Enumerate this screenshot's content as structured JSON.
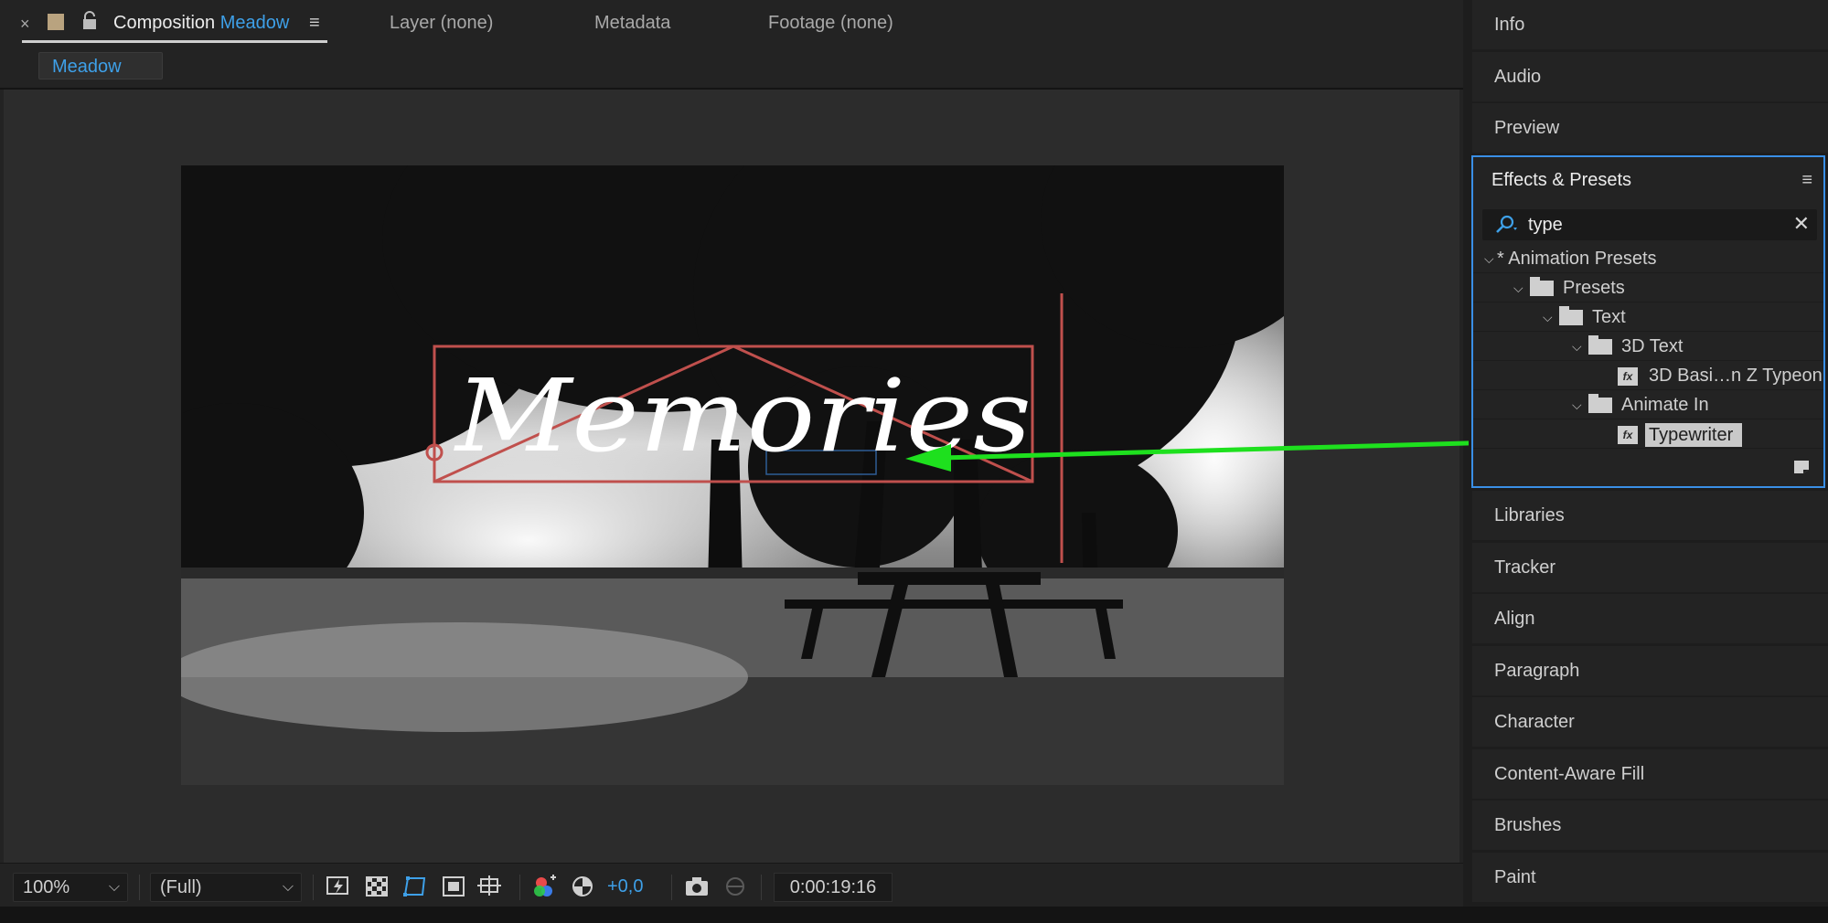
{
  "tabs": {
    "composition_prefix": "Composition",
    "composition_name": "Meadow",
    "layer": "Layer (none)",
    "metadata": "Metadata",
    "footage": "Footage (none)",
    "close_glyph": "×",
    "menu_glyph": "≡"
  },
  "breadcrumb": {
    "current": "Meadow"
  },
  "viewer": {
    "scene_text": "Memories"
  },
  "toolbar": {
    "zoom": "100%",
    "resolution": "(Full)",
    "exposure": "+0,0",
    "timecode": "0:00:19:16",
    "chevron": "⌵"
  },
  "right_panels": {
    "top": [
      "Info",
      "Audio",
      "Preview"
    ],
    "bottom": [
      "Libraries",
      "Tracker",
      "Align",
      "Paragraph",
      "Character",
      "Content-Aware Fill",
      "Brushes",
      "Paint"
    ]
  },
  "effects": {
    "title": "Effects & Presets",
    "menu_glyph": "≡",
    "search_value": "type",
    "clear_glyph": "✕",
    "tree": [
      {
        "label": "* Animation Presets",
        "depth": 0,
        "kind": "folder-root"
      },
      {
        "label": "Presets",
        "depth": 1,
        "kind": "folder"
      },
      {
        "label": "Text",
        "depth": 2,
        "kind": "folder"
      },
      {
        "label": "3D Text",
        "depth": 3,
        "kind": "folder"
      },
      {
        "label": "3D Basi…n Z Typeon",
        "depth": 4,
        "kind": "preset"
      },
      {
        "label": "Animate In",
        "depth": 3,
        "kind": "folder"
      },
      {
        "label": "Typewriter",
        "depth": 4,
        "kind": "preset",
        "selected": true
      }
    ]
  },
  "colors": {
    "accent_blue": "#3ea0e8",
    "guide_red": "#c0504d",
    "arrow_green": "#1ee01e",
    "panel_bg": "#232323"
  }
}
